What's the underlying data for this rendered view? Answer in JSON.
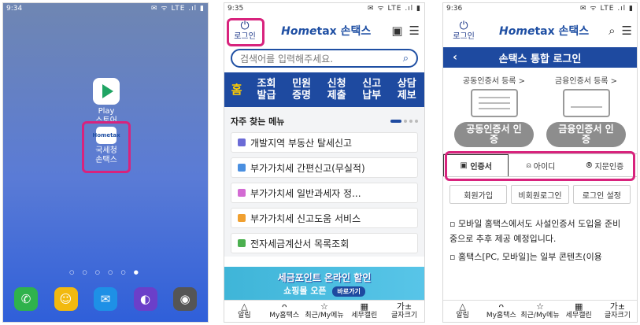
{
  "phone1": {
    "status": {
      "time": "9:34",
      "right": "✉ ᯤ LTE .ıl ▮"
    },
    "apps": {
      "play": {
        "label": "Play\n스토어"
      },
      "hometax": {
        "label": "국세청\n손택스",
        "icon_text": "Hometax"
      }
    },
    "page_dots": "○ ○ ○ ○ ○ ●",
    "colors": {
      "highlight": "#d8237d"
    }
  },
  "phone2": {
    "status": {
      "time": "9:35",
      "right": "✉ ᯤ LTE .ıl ▮"
    },
    "header": {
      "login_label": "로그인",
      "logo_home": "Home",
      "logo_tax": "tax",
      "logo_korean": "손택스"
    },
    "search": {
      "placeholder": "검색어를 입력해주세요."
    },
    "categories": [
      {
        "label": "홈"
      },
      {
        "label": "조회\n발급"
      },
      {
        "label": "민원\n증명"
      },
      {
        "label": "신청\n제출"
      },
      {
        "label": "신고\n납부"
      },
      {
        "label": "상담\n제보"
      }
    ],
    "freq_menu": {
      "title": "자주 찾는 메뉴",
      "items": [
        {
          "label": "개발지역 부동산 탈세신고",
          "color": "#6b6bd6"
        },
        {
          "label": "부가가치세 간편신고(무실적)",
          "color": "#4a8fe0"
        },
        {
          "label": "부가가치세 일반과세자 정...",
          "color": "#d36bd3"
        },
        {
          "label": "부가가치세 신고도움 서비스",
          "color": "#f0a030"
        },
        {
          "label": "전자세금계산서 목록조회",
          "color": "#4cb050"
        }
      ]
    },
    "banner": {
      "line1": "세금포인트 온라인 할인",
      "line2": "쇼핑몰 오픈",
      "go": "바로가기"
    }
  },
  "phone3": {
    "status": {
      "time": "9:36",
      "right": "✉ ᯤ LTE .ıl ▮"
    },
    "header": {
      "login_label": "로그인",
      "logo_home": "Home",
      "logo_tax": "tax",
      "logo_korean": "손택스"
    },
    "title": "손택스 통합 로그인",
    "certs": [
      {
        "register": "공동인증서 등록 >",
        "button": "공동인증서 인\n증"
      },
      {
        "register": "금융인증서 등록 >",
        "button": "금융인증서 인\n증"
      }
    ],
    "auth_tabs": [
      {
        "label": "인증서",
        "icon": "▣"
      },
      {
        "label": "아이디",
        "icon": "⍝"
      },
      {
        "label": "지문인증",
        "icon": "⦾"
      }
    ],
    "links": [
      "회원가입",
      "비회원로그인",
      "로그인 설정"
    ],
    "notices": [
      "모바일 홈택스에서도 사설인증서 도입을 준비 중으로 추후 제공 예정입니다.",
      "홈택스[PC, 모바일]는 일부 콘텐츠(이용"
    ]
  },
  "bottom_nav": [
    {
      "label": "알림",
      "icon": "🔔"
    },
    {
      "label": "My홈택스",
      "icon": "👤"
    },
    {
      "label": "최근/My메뉴",
      "icon": "☆"
    },
    {
      "label": "세무캘린",
      "icon": "▦"
    },
    {
      "label": "글자크기",
      "icon": "가±"
    }
  ]
}
